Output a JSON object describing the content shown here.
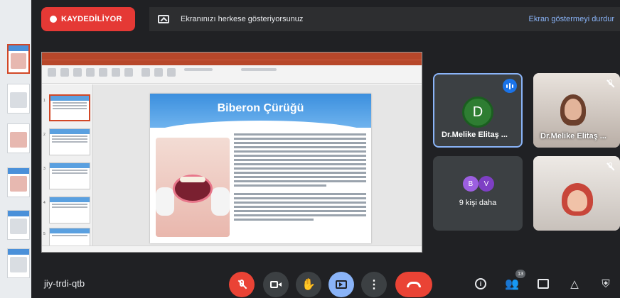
{
  "top_bar": {
    "recording_label": "KAYDEDİLİYOR",
    "share_notice": "Ekranınızı herkese gösteriyorsunuz",
    "stop_sharing": "Ekran göstermeyi durdur"
  },
  "slide": {
    "title": "Biberon Çürüğü"
  },
  "participants": [
    {
      "name": "Dr.Melike Elitaş ...",
      "initial": "D",
      "avatar_color": "#2e7d32",
      "speaking": true
    },
    {
      "name": "Dr.Melike Elitaş ...",
      "muted": true
    }
  ],
  "others": {
    "initials": [
      "B",
      "V"
    ],
    "colors": [
      "#9c5fe0",
      "#7e3fc4"
    ],
    "label": "9 kişi daha"
  },
  "bottom_bar": {
    "meeting_code": "jiy-trdi-qtb",
    "participant_count": "13"
  },
  "colors": {
    "background": "#202124",
    "recording": "#e53935",
    "accent": "#8ab4f8",
    "end_call": "#ea4335"
  }
}
